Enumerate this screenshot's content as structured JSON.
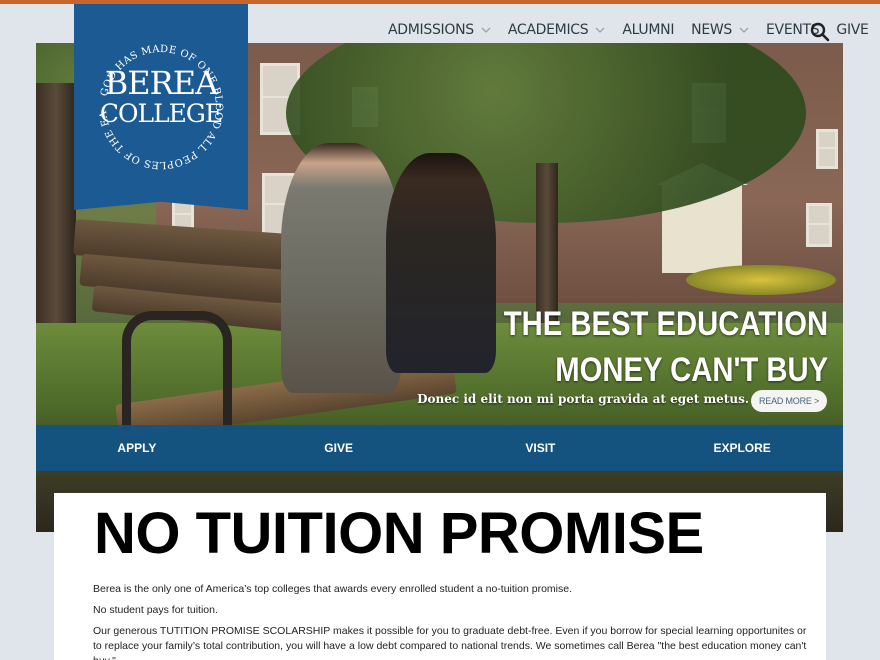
{
  "colors": {
    "accent_strip": "#c9642a",
    "brand_blue": "#1b5a93",
    "action_bar": "#115387"
  },
  "logo": {
    "line1": "BEREA",
    "line2": "COLLEGE",
    "motto": "GOD HAS MADE OF ONE BLOOD ALL PEOPLES OF THE EARTH"
  },
  "nav": {
    "items": [
      {
        "label": "ADMISSIONS",
        "has_dropdown": true
      },
      {
        "label": "ACADEMICS",
        "has_dropdown": true
      },
      {
        "label": "ALUMNI",
        "has_dropdown": false
      },
      {
        "label": "NEWS",
        "has_dropdown": true
      },
      {
        "label": "EVENTS",
        "has_dropdown": false
      },
      {
        "label": "GIVE",
        "has_dropdown": false
      }
    ],
    "search_icon": "search-icon"
  },
  "hero": {
    "title_line1": "THE BEST EDUCATION",
    "title_line2": "MONEY CAN'T BUY",
    "subtitle": "Donec id elit non mi porta gravida at eget metus.",
    "read_more": "READ MORE >"
  },
  "actions": [
    {
      "label": "APPLY"
    },
    {
      "label": "GIVE"
    },
    {
      "label": "VISIT"
    },
    {
      "label": "EXPLORE"
    }
  ],
  "content": {
    "heading": "NO TUITION PROMISE",
    "paragraphs": [
      "Berea is the only one of America’s top colleges that awards every enrolled student a no-tuition promise.",
      "No student pays for tuition.",
      "Our generous TUTITION PROMISE SCOLARSHIP makes it possible for you to graduate debt-free. Even if you borrow for special learning opportunites or to replace your family’s total contribution, you will have a low debt compared to national trends. We sometimes call Berea \"the best education money can't buy.\""
    ]
  }
}
